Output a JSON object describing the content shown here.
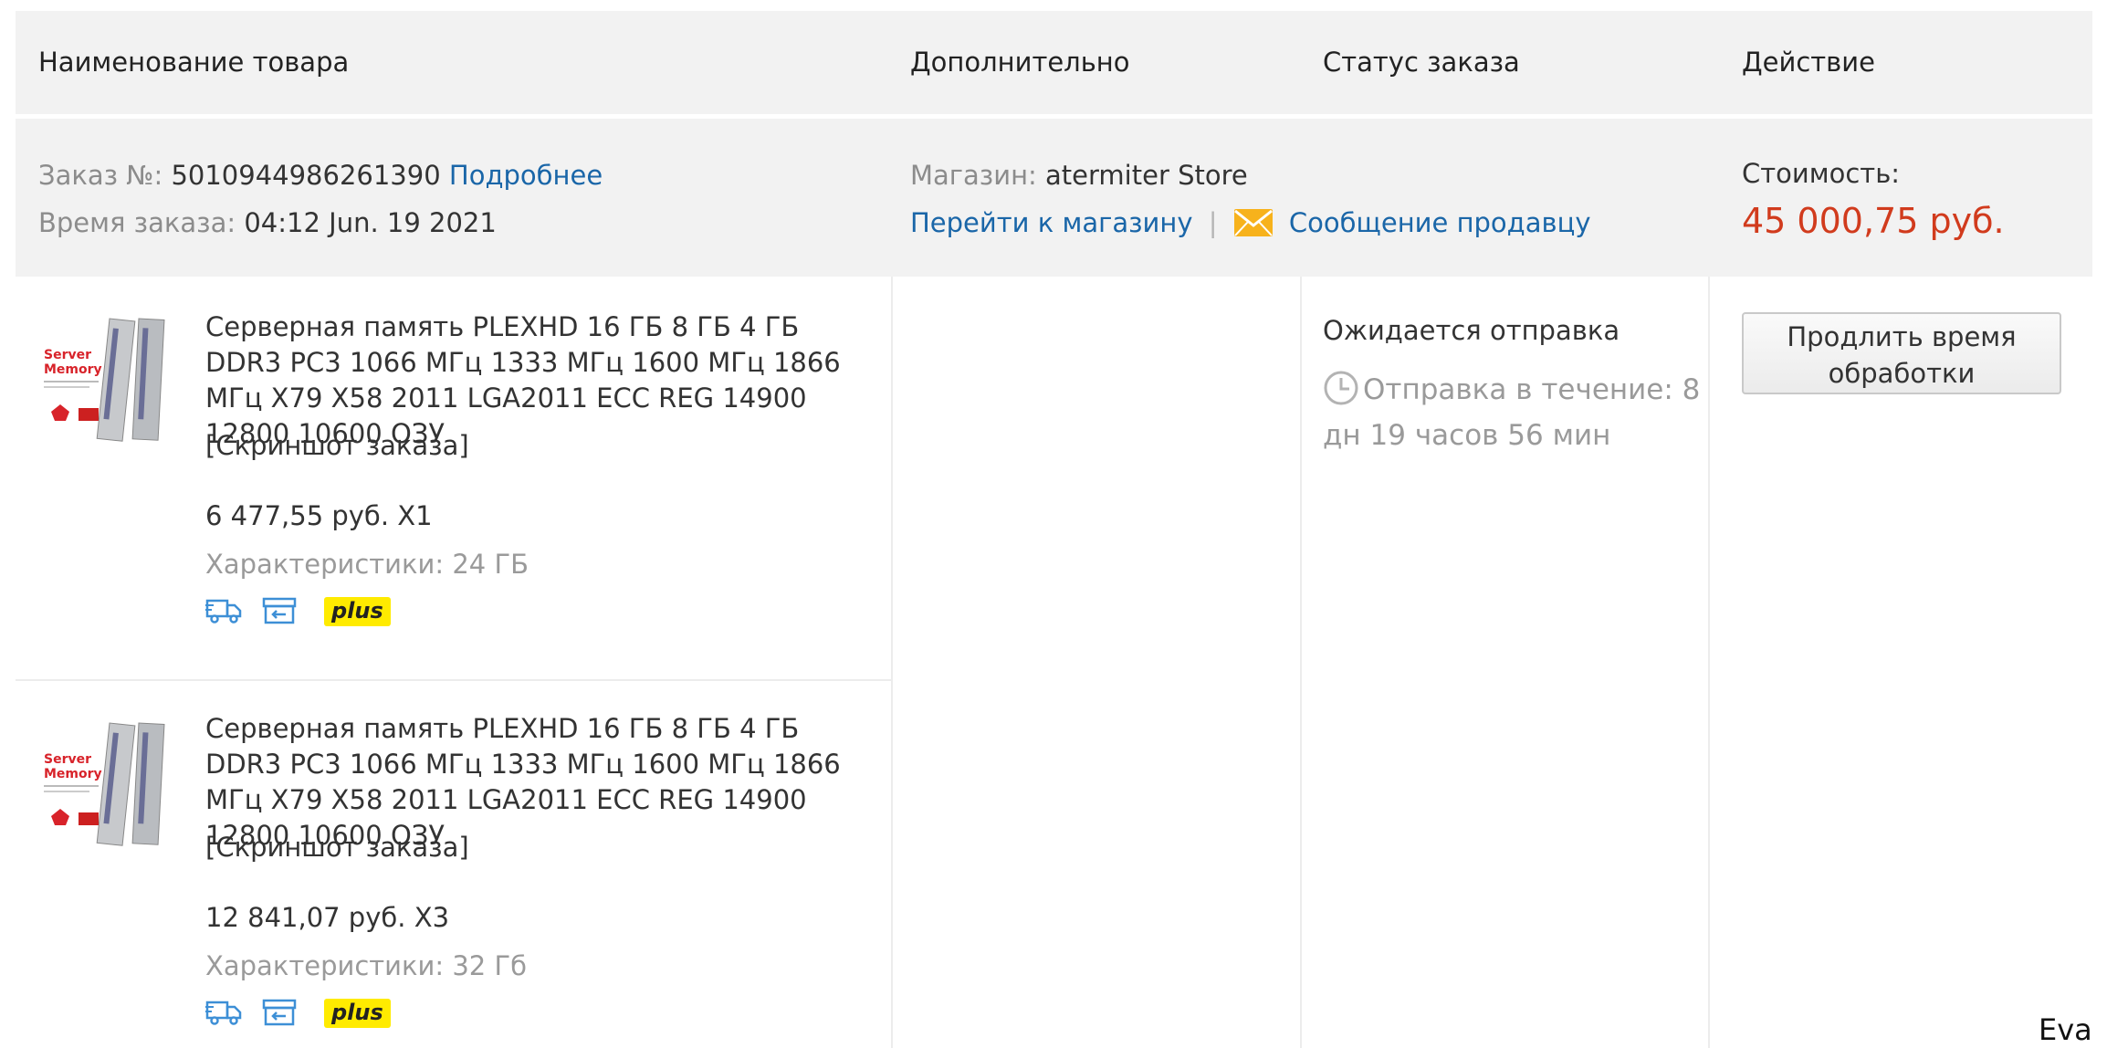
{
  "table_header": {
    "col_product": "Наименование товара",
    "col_extra": "Дополнительно",
    "col_status": "Статус заказа",
    "col_action": "Действие"
  },
  "order": {
    "number_label": "Заказ №:",
    "number": "5010944986261390",
    "details_link": "Подробнее",
    "time_label": "Время заказа:",
    "time": "04:12 Jun. 19 2021",
    "store_label": "Магазин:",
    "store_name": "atermiter Store",
    "go_to_store_link": "Перейти к магазину",
    "separator": "|",
    "message_seller_link": "Сообщение продавцу",
    "cost_label": "Стоимость:",
    "cost": "45 000,75 руб."
  },
  "products": [
    {
      "title": "Серверная память PLEXHD 16 ГБ 8 ГБ 4 ГБ DDR3 PC3 1066 МГц 1333 МГц 1600 МГц 1866 МГц X79 X58 2011 LGA2011 ECC REG 14900 12800 10600 ОЗУ",
      "snapshot_link": "[Скриншот заказа]",
      "price_qty": "6 477,55 руб. X1",
      "spec": "Характеристики: 24 ГБ",
      "badge": "plus",
      "icons": [
        "delivery-truck-icon",
        "return-box-icon"
      ]
    },
    {
      "title": "Серверная память PLEXHD 16 ГБ 8 ГБ 4 ГБ DDR3 PC3 1066 МГц 1333 МГц 1600 МГц 1866 МГц X79 X58 2011 LGA2011 ECC REG 14900 12800 10600 ОЗУ",
      "snapshot_link": "[Скриншот заказа]",
      "price_qty": "12 841,07 руб. X3",
      "spec": "Характеристики: 32 Гб",
      "badge": "plus",
      "icons": [
        "delivery-truck-icon",
        "return-box-icon"
      ]
    }
  ],
  "status": {
    "main": "Ожидается отправка",
    "countdown": "Отправка в течение: 8 дн 19 часов 56 мин"
  },
  "action": {
    "extend_button": "Продлить время обработки"
  },
  "watermark": "Eva",
  "colors": {
    "header_bg": "#f2f2f2",
    "link": "#1a66a8",
    "price": "#d13b1d",
    "plus_badge": "#ffeb00",
    "icon_blue": "#3d8fd6"
  }
}
